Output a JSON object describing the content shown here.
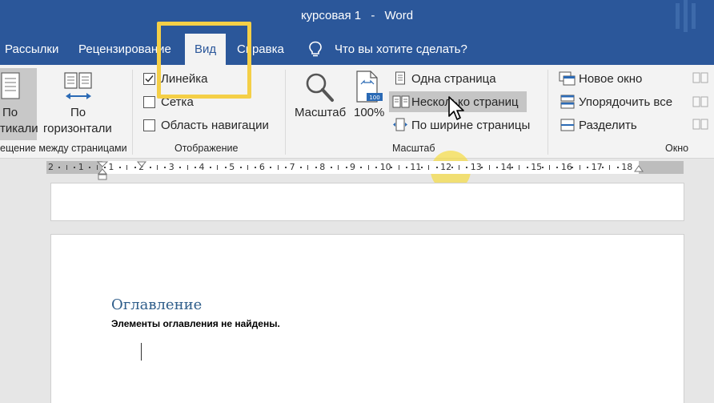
{
  "window": {
    "title_doc": "курсовая 1",
    "title_sep": "-",
    "title_app": "Word"
  },
  "tabs": [
    {
      "label": "Рассылки"
    },
    {
      "label": "Рецензирование"
    },
    {
      "label": "Вид"
    },
    {
      "label": "Справка"
    }
  ],
  "tell_me": "Что вы хотите сделать?",
  "ribbon": {
    "page_movement": {
      "vertical_label_1": "По",
      "vertical_label_2": "тикали",
      "horizontal_label_1": "По",
      "horizontal_label_2": "горизонтали",
      "group_label": "ещение между страницами"
    },
    "show": {
      "ruler": "Линейка",
      "ruler_checked": true,
      "grid": "Сетка",
      "grid_checked": false,
      "nav_pane": "Область навигации",
      "nav_pane_checked": false,
      "group_label": "Отображение"
    },
    "zoom": {
      "zoom_label": "Масштаб",
      "hundred_label": "100%",
      "hundred_badge": "100",
      "one_page": "Одна страница",
      "multiple_pages": "Несколько страниц",
      "page_width": "По ширине страницы",
      "group_label": "Масштаб"
    },
    "window_group": {
      "new_window": "Новое окно",
      "arrange_all": "Упорядочить все",
      "split": "Разделить",
      "group_label": "Окно"
    }
  },
  "ruler": {
    "numbers": [
      "2",
      "1",
      "1",
      "2",
      "3",
      "4",
      "5",
      "6",
      "7",
      "8",
      "9",
      "10",
      "11",
      "12",
      "13",
      "14",
      "15",
      "16",
      "17",
      "18"
    ]
  },
  "document": {
    "toc_heading": "Оглавление",
    "toc_empty_message": "Элементы оглавления не найдены."
  },
  "colors": {
    "ribbon_blue": "#2b579a",
    "highlight_yellow": "#f4cf47",
    "heading_blue": "#2e5d8a"
  }
}
